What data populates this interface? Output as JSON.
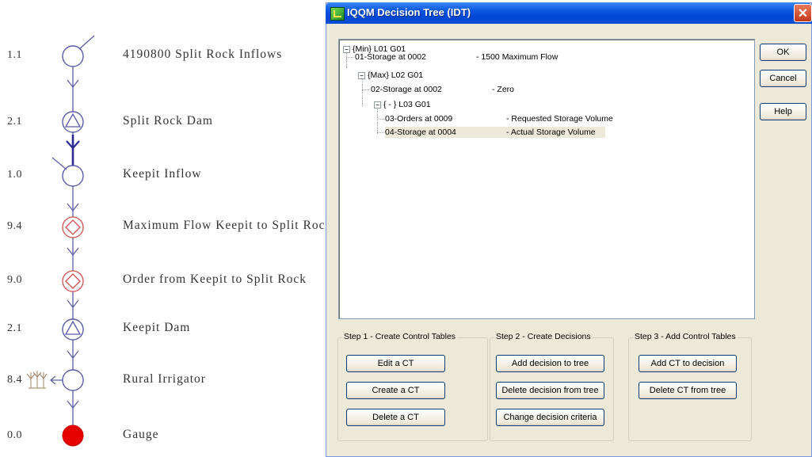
{
  "diagram": {
    "nodes": [
      {
        "code": "1.1",
        "label": "4190800 Split Rock Inflows",
        "shape": "circle",
        "inflow": true
      },
      {
        "code": "2.1",
        "label": "Split Rock Dam",
        "shape": "dam"
      },
      {
        "code": "1.0",
        "label": "Keepit Inflow",
        "shape": "circle",
        "inflow": true
      },
      {
        "code": "9.4",
        "label": "Maximum Flow Keepit to Split Rock",
        "shape": "diamond"
      },
      {
        "code": "9.0",
        "label": "Order from Keepit to Split Rock",
        "shape": "diamond"
      },
      {
        "code": "2.1",
        "label": "Keepit Dam",
        "shape": "dam"
      },
      {
        "code": "8.4",
        "label": "Rural Irrigator",
        "shape": "circle",
        "irrigator": true
      },
      {
        "code": "0.0",
        "label": "Gauge",
        "shape": "filled"
      }
    ],
    "colors": {
      "line": "#3a3aa0",
      "diamond": "#d05050",
      "gauge": "#e60000",
      "irrigator": "#a08060"
    }
  },
  "dialog": {
    "title": "IQQM Decision Tree (IDT)",
    "close_symbol": "✕",
    "tree": [
      {
        "label": "{Min} L01 G01",
        "desc": ""
      },
      {
        "label": "01-Storage at 0002",
        "desc": "- 1500 Maximum Flow"
      },
      {
        "label": "{Max} L02 G01",
        "desc": ""
      },
      {
        "label": "02-Storage at 0002",
        "desc": "- Zero"
      },
      {
        "label": "{ - } L03 G01",
        "desc": ""
      },
      {
        "label": "03-Orders at 0009",
        "desc": "- Requested Storage Volume"
      },
      {
        "label": "04-Storage at 0004",
        "desc": "- Actual Storage Volume"
      }
    ],
    "expander_symbol": "−",
    "side_buttons": {
      "ok": "OK",
      "cancel": "Cancel",
      "help": "Help"
    },
    "step1": {
      "title": "Step 1 - Create Control Tables",
      "buttons": [
        "Edit a CT",
        "Create a CT",
        "Delete a CT"
      ]
    },
    "step2": {
      "title": "Step 2 - Create Decisions",
      "buttons": [
        "Add decision to tree",
        "Delete decision from tree",
        "Change decision criteria"
      ]
    },
    "step3": {
      "title": "Step 3 - Add Control Tables",
      "buttons": [
        "Add CT to decision",
        "Delete CT from tree"
      ]
    },
    "colors": {
      "titlebar": "#0a56e0",
      "window": "#ece9d8",
      "selection": "#ece9d8"
    }
  }
}
